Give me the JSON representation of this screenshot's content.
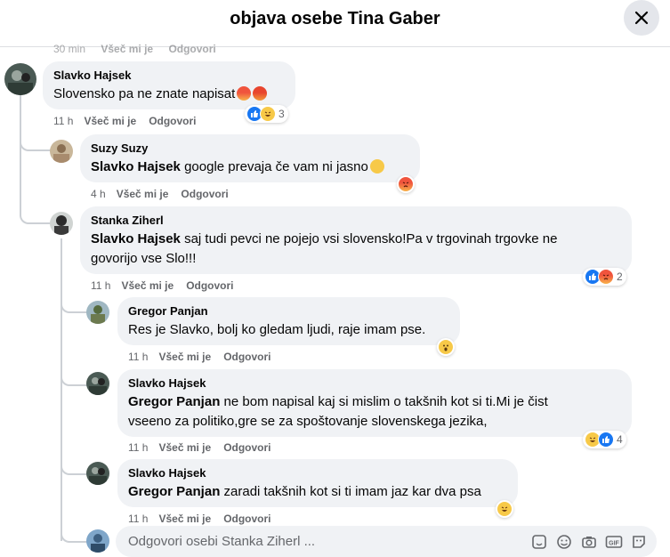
{
  "header": {
    "title": "objava osebe Tina Gaber"
  },
  "top_meta": {
    "time": "30 min",
    "like": "Všeč mi je",
    "reply": "Odgovori"
  },
  "comments": [
    {
      "author": "Slavko Hajsek",
      "text": "Slovensko pa ne znate napisat",
      "time": "11 h",
      "like": "Všeč mi je",
      "reply": "Odgovori",
      "reaction_count": "3"
    },
    {
      "author": "Suzy Suzy",
      "mention": "Slavko Hajsek",
      "text": " google prevaja če vam ni jasno",
      "time": "4 h",
      "like": "Všeč mi je",
      "reply": "Odgovori"
    },
    {
      "author": "Stanka Ziherl",
      "mention": "Slavko Hajsek",
      "text_line1": " saj tudi pevci ne pojejo vsi slovensko!Pa v trgovinah trgovke ne",
      "text_line2": "govorijo vse Slo!!!",
      "time": "11 h",
      "like": "Všeč mi je",
      "reply": "Odgovori",
      "reaction_count": "2"
    },
    {
      "author": "Gregor Panjan",
      "text": "Res je Slavko, bolj ko gledam ljudi, raje imam pse.",
      "time": "11 h",
      "like": "Všeč mi je",
      "reply": "Odgovori"
    },
    {
      "author": "Slavko Hajsek",
      "mention": "Gregor Panjan",
      "text_line1": " ne bom napisal kaj si mislim o takšnih kot si ti.Mi je čist",
      "text_line2": "vseeno za politiko,gre se za spoštovanje slovenskega jezika,",
      "time": "11 h",
      "like": "Všeč mi je",
      "reply": "Odgovori",
      "reaction_count": "4"
    },
    {
      "author": "Slavko Hajsek",
      "mention": "Gregor Panjan",
      "text": " zaradi takšnih kot si ti imam jaz kar dva psa",
      "time": "11 h",
      "like": "Všeč mi je",
      "reply": "Odgovori"
    }
  ],
  "reply_box": {
    "placeholder": "Odgovori osebi Stanka Ziherl ..."
  },
  "icons": [
    "close-icon",
    "like-reaction-icon",
    "angry-reaction-icon",
    "haha-reaction-icon",
    "wow-reaction-icon",
    "sticker-icon",
    "emoji-icon",
    "camera-icon",
    "gif-icon",
    "sticker-smile-icon"
  ],
  "colors": {
    "bubble": "#f0f2f5",
    "like": "#1877f2",
    "meta": "#65676b",
    "thread_line": "#ccd0d5"
  }
}
